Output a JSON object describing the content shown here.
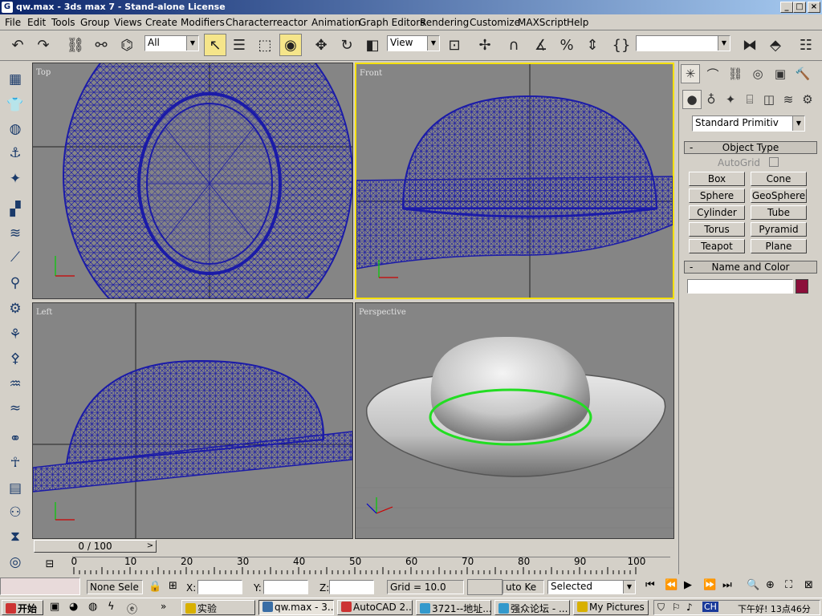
{
  "window": {
    "title": "qw.max - 3ds max 7 - Stand-alone License",
    "min": "_",
    "max": "□",
    "close": "×"
  },
  "menu": [
    "File",
    "Edit",
    "Tools",
    "Group",
    "Views",
    "Create",
    "Modifiers",
    "Character",
    "reactor",
    "Animation",
    "Graph Editors",
    "Rendering",
    "Customize",
    "MAXScript",
    "Help"
  ],
  "toolbar": {
    "selection_filter": "All",
    "reference_coord": "View",
    "named_selection": ""
  },
  "viewports": {
    "top": "Top",
    "front": "Front",
    "left": "Left",
    "perspective": "Perspective"
  },
  "command_panel": {
    "category_dropdown": "Standard Primitiv",
    "object_type_title": "Object Type",
    "autogrid": "AutoGrid",
    "buttons": [
      "Box",
      "Cone",
      "Sphere",
      "GeoSphere",
      "Cylinder",
      "Tube",
      "Torus",
      "Pyramid",
      "Teapot",
      "Plane"
    ],
    "name_color_title": "Name and Color",
    "object_name": "",
    "object_color": "#8c0f3a"
  },
  "timeline": {
    "slider": "0 / 100",
    "ticks": [
      "0",
      "10",
      "20",
      "30",
      "40",
      "50",
      "60",
      "70",
      "80",
      "90",
      "100"
    ]
  },
  "status": {
    "selection": "None Sele",
    "x_label": "X:",
    "y_label": "Y:",
    "z_label": "Z:",
    "grid": "Grid = 10.0",
    "autokey": "uto Ke",
    "key_filter": "Selected"
  },
  "taskbar": {
    "start": "开始",
    "tasks": [
      "实验",
      "qw.max - 3...",
      "AutoCAD 2...",
      "3721--地址...",
      "强众论坛 - ...",
      "My Pictures ..."
    ],
    "tray_lang": "CH",
    "clock": "下午好! 13点46分"
  }
}
